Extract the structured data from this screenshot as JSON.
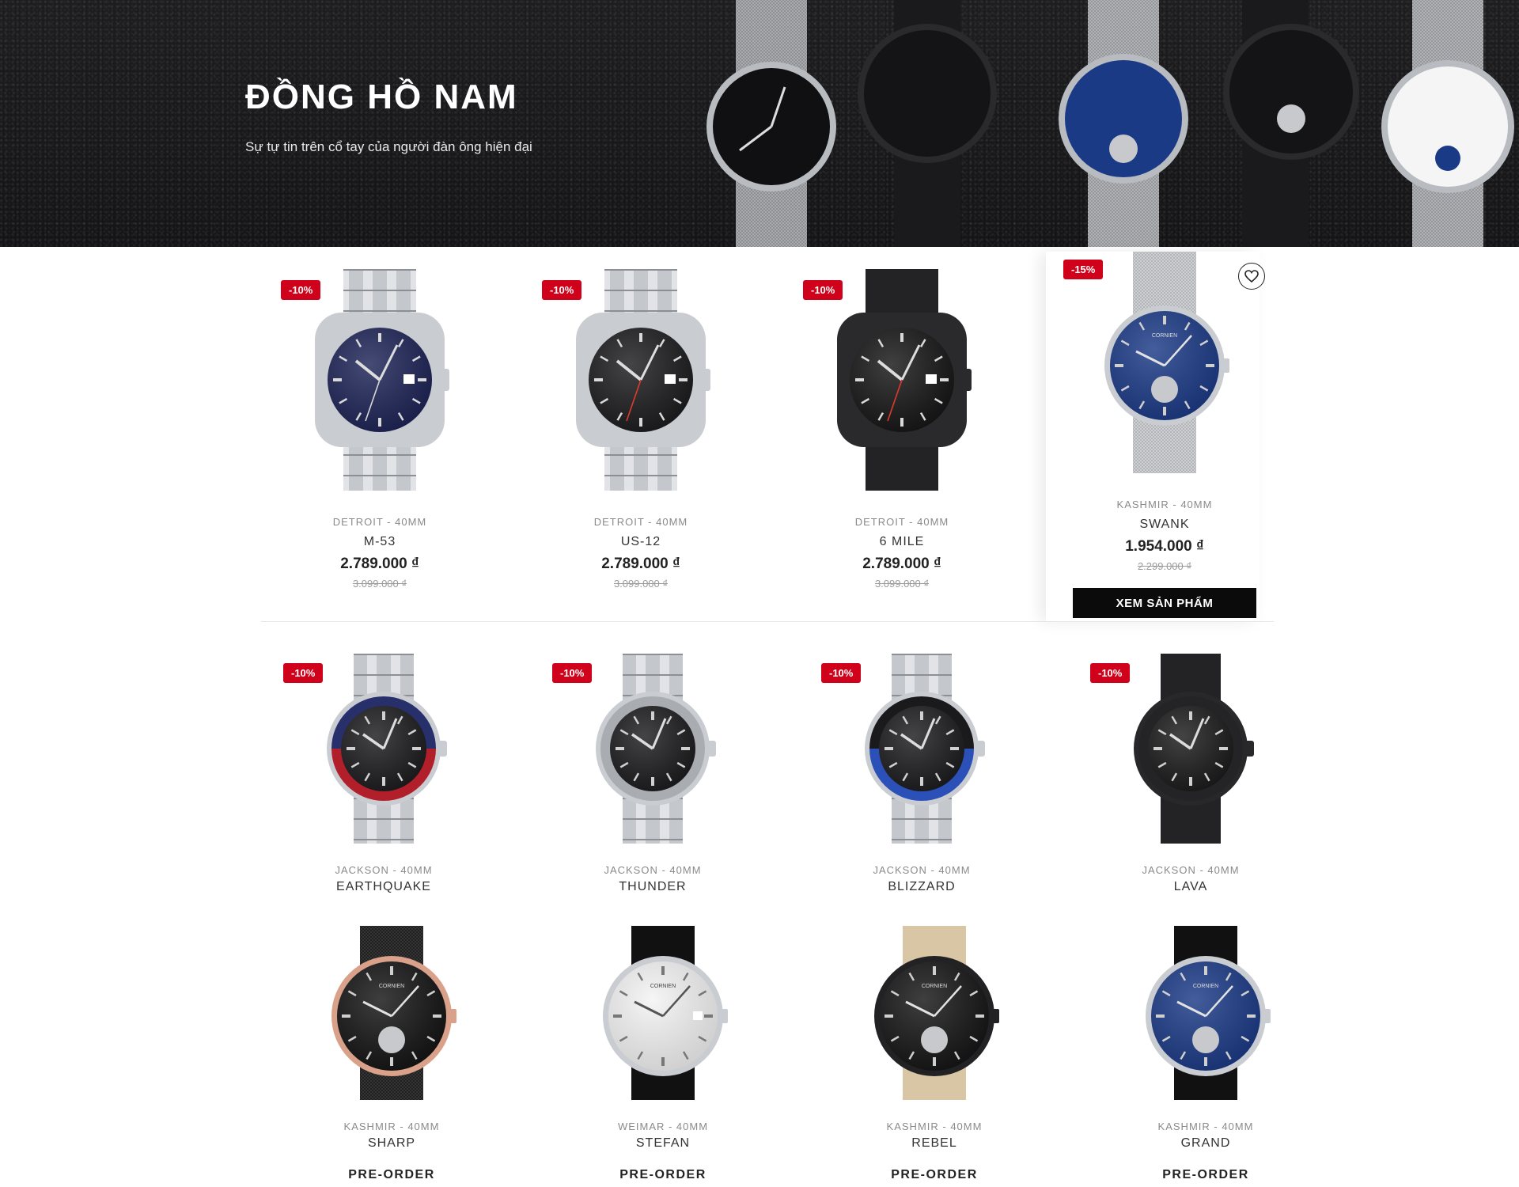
{
  "hero": {
    "title": "ĐỒNG HỒ NAM",
    "subtitle": "Sự tự tin trên cổ tay của người đàn ông hiện đại"
  },
  "row1": [
    {
      "badge": "-10%",
      "collection": "DETROIT - 40MM",
      "name": "M-53",
      "price": "2.789.000 ₫",
      "old_price": "3.099.000 ₫",
      "dial": "#1d2456",
      "case": "#c9ccd1",
      "strap": "bracelet-silver",
      "hand": "#d8d8d8"
    },
    {
      "badge": "-10%",
      "collection": "DETROIT - 40MM",
      "name": "US-12",
      "price": "2.789.000 ₫",
      "old_price": "3.099.000 ₫",
      "dial": "#1c1c1e",
      "case": "#c9ccd1",
      "strap": "bracelet-silver",
      "hand": "#e03a2f"
    },
    {
      "badge": "-10%",
      "collection": "DETROIT - 40MM",
      "name": "6 MILE",
      "price": "2.789.000 ₫",
      "old_price": "3.099.000 ₫",
      "dial": "#161616",
      "case": "#2a2a2c",
      "strap": "bracelet-black",
      "hand": "#e03a2f"
    },
    {
      "badge": "-15%",
      "collection": "KASHMIR - 40MM",
      "name": "SWANK",
      "price": "1.954.000 ₫",
      "old_price": "2.299.000 ₫",
      "dial": "#1b3a86",
      "case": "#c9ccd1",
      "strap": "mesh-silver",
      "hand": "#dcdcdc"
    }
  ],
  "featured": {
    "button_label": "XEM SẢN PHẨM",
    "wishlist_icon": "heart-icon"
  },
  "row2": [
    {
      "badge": "-10%",
      "collection": "JACKSON - 40MM",
      "name": "EARTHQUAKE",
      "dial": "#1c1c1e",
      "bezel_top": "#28306b",
      "bezel_bottom": "#b1202a",
      "strap": "bracelet-silver"
    },
    {
      "badge": "-10%",
      "collection": "JACKSON - 40MM",
      "name": "THUNDER",
      "dial": "#1c1c1e",
      "bezel_top": "#a9acb1",
      "bezel_bottom": "#a9acb1",
      "strap": "bracelet-silver"
    },
    {
      "badge": "-10%",
      "collection": "JACKSON - 40MM",
      "name": "BLIZZARD",
      "dial": "#1c1c1e",
      "bezel_top": "#1a1a1c",
      "bezel_bottom": "#2b50b8",
      "strap": "bracelet-silver"
    },
    {
      "badge": "-10%",
      "collection": "JACKSON - 40MM",
      "name": "LAVA",
      "dial": "#1b1b1b",
      "bezel_top": "#242426",
      "bezel_bottom": "#242426",
      "strap": "bracelet-black"
    }
  ],
  "row3": [
    {
      "collection": "KASHMIR - 40MM",
      "name": "SHARP",
      "cta": "PRE-ORDER",
      "dial": "#141414",
      "case": "#d9a08a",
      "strap": "mesh-black"
    },
    {
      "collection": "WEIMAR - 40MM",
      "name": "STEFAN",
      "cta": "PRE-ORDER",
      "dial": "#f4f4f4",
      "case": "#c9ccd1",
      "strap": "leather-black"
    },
    {
      "collection": "KASHMIR - 40MM",
      "name": "REBEL",
      "cta": "PRE-ORDER",
      "dial": "#151515",
      "case": "#222224",
      "strap": "leather-tan"
    },
    {
      "collection": "KASHMIR - 40MM",
      "name": "GRAND",
      "cta": "PRE-ORDER",
      "dial": "#1b3a86",
      "case": "#c9ccd1",
      "strap": "leather-black"
    }
  ]
}
